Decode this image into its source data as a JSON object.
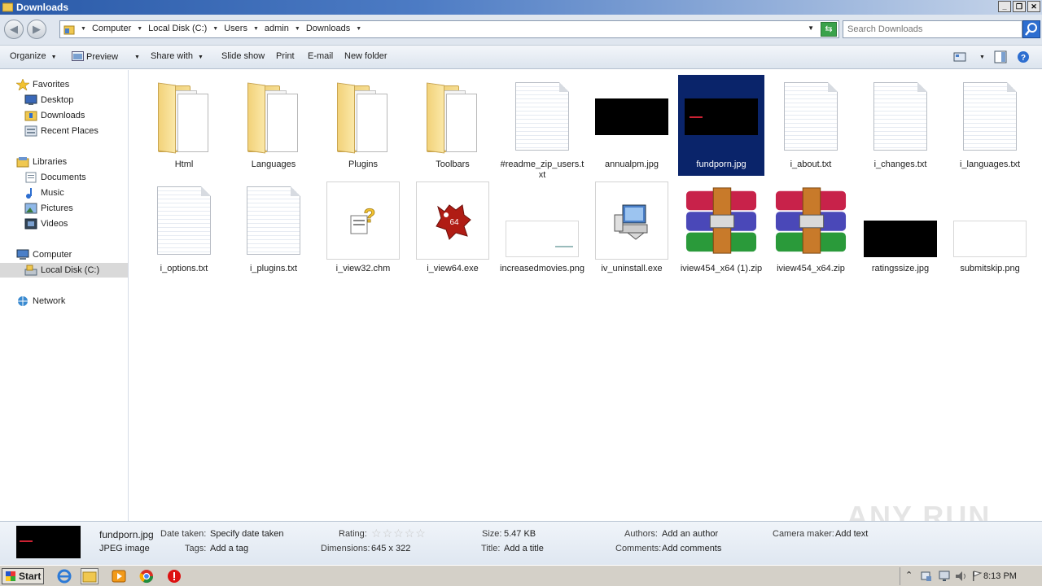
{
  "window": {
    "title": "Downloads"
  },
  "address": {
    "crumbs": [
      "Computer",
      "Local Disk (C:)",
      "Users",
      "admin",
      "Downloads"
    ],
    "search_placeholder": "Search Downloads"
  },
  "toolbar": {
    "organize": "Organize",
    "preview": "Preview",
    "share_with": "Share with",
    "slide_show": "Slide show",
    "print": "Print",
    "email": "E-mail",
    "new_folder": "New folder"
  },
  "nav": {
    "favorites": "Favorites",
    "desktop": "Desktop",
    "downloads": "Downloads",
    "recent_places": "Recent Places",
    "libraries": "Libraries",
    "documents": "Documents",
    "music": "Music",
    "pictures": "Pictures",
    "videos": "Videos",
    "computer": "Computer",
    "local_disk": "Local Disk (C:)",
    "network": "Network"
  },
  "files": [
    {
      "name": "Html",
      "kind": "folder"
    },
    {
      "name": "Languages",
      "kind": "folder"
    },
    {
      "name": "Plugins",
      "kind": "folder"
    },
    {
      "name": "Toolbars",
      "kind": "folder"
    },
    {
      "name": "#readme_zip_users.txt",
      "kind": "text"
    },
    {
      "name": "annualpm.jpg",
      "kind": "black-image"
    },
    {
      "name": "fundporn.jpg",
      "kind": "black-image",
      "selected": true
    },
    {
      "name": "i_about.txt",
      "kind": "text"
    },
    {
      "name": "i_changes.txt",
      "kind": "text"
    },
    {
      "name": "i_languages.txt",
      "kind": "text"
    },
    {
      "name": "i_options.txt",
      "kind": "text"
    },
    {
      "name": "i_plugins.txt",
      "kind": "text"
    },
    {
      "name": "i_view32.chm",
      "kind": "help"
    },
    {
      "name": "i_view64.exe",
      "kind": "irfanview"
    },
    {
      "name": "increasedmovies.png",
      "kind": "white-image"
    },
    {
      "name": "iv_uninstall.exe",
      "kind": "installer"
    },
    {
      "name": "iview454_x64 (1).zip",
      "kind": "archive"
    },
    {
      "name": "iview454_x64.zip",
      "kind": "archive"
    },
    {
      "name": "ratingssize.jpg",
      "kind": "black-image"
    },
    {
      "name": "submitskip.png",
      "kind": "white-image"
    }
  ],
  "details": {
    "filename": "fundporn.jpg",
    "filetype": "JPEG image",
    "date_taken_label": "Date taken:",
    "date_taken_value": "Specify date taken",
    "tags_label": "Tags:",
    "tags_value": "Add a tag",
    "rating_label": "Rating:",
    "rating_stars": 0,
    "dimensions_label": "Dimensions:",
    "dimensions_value": "645 x 322",
    "size_label": "Size:",
    "size_value": "5.47 KB",
    "title_label": "Title:",
    "title_value": "Add a title",
    "authors_label": "Authors:",
    "authors_value": "Add an author",
    "comments_label": "Comments:",
    "comments_value": "Add comments",
    "camera_label": "Camera maker:",
    "camera_value": "Add text"
  },
  "taskbar": {
    "start": "Start",
    "clock": "8:13 PM"
  },
  "colors": {
    "selection": "#0a246a",
    "titlebar": "#2a5aa8"
  }
}
